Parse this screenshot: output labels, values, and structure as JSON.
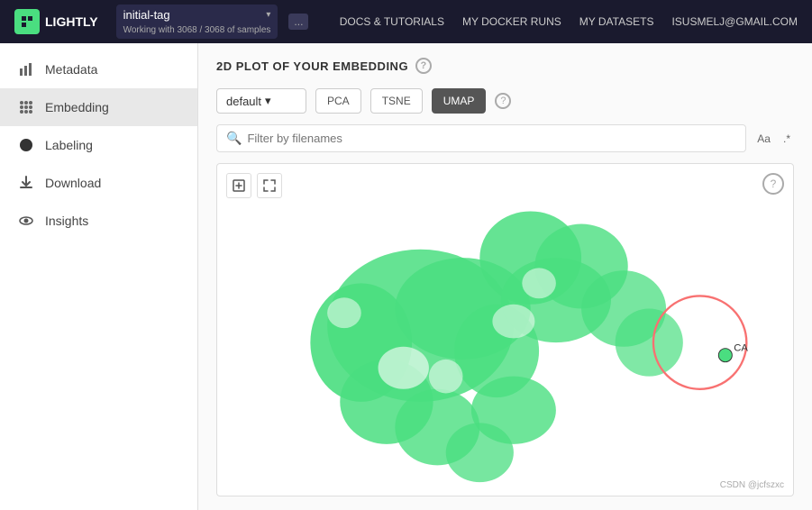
{
  "navbar": {
    "logo_text": "LIGHTLY",
    "logo_char": "L",
    "tag_name": "initial-tag",
    "tag_subtitle": "Working with 3068 / 3068 of samples",
    "tag_more_label": "...",
    "links": [
      {
        "label": "DOCS & TUTORIALS",
        "key": "docs"
      },
      {
        "label": "MY DOCKER RUNS",
        "key": "docker"
      },
      {
        "label": "MY DATASETS",
        "key": "datasets"
      },
      {
        "label": "ISUSMELJ@GMAIL.COM",
        "key": "user"
      }
    ]
  },
  "sidebar": {
    "items": [
      {
        "label": "Metadata",
        "icon": "chart-icon",
        "active": false,
        "key": "metadata"
      },
      {
        "label": "Embedding",
        "icon": "grid-icon",
        "active": true,
        "key": "embedding"
      },
      {
        "label": "Labeling",
        "icon": "circle-icon",
        "active": false,
        "key": "labeling"
      },
      {
        "label": "Download",
        "icon": "download-icon",
        "active": false,
        "key": "download"
      },
      {
        "label": "Insights",
        "icon": "eye-icon",
        "active": false,
        "key": "insights"
      }
    ]
  },
  "main": {
    "section_title": "2D PLOT OF YOUR EMBEDDING",
    "dropdown_default": "default",
    "methods": [
      {
        "label": "PCA",
        "active": false
      },
      {
        "label": "TSNE",
        "active": false
      },
      {
        "label": "UMAP",
        "active": true
      }
    ],
    "search_placeholder": "Filter by filenames",
    "text_case_label": "Aa",
    "text_regex_label": ".*",
    "plot": {
      "cluster_color": "#4ade80",
      "circle_color": "#f87171",
      "cursor_label": "CA"
    }
  },
  "watermark": "CSDN @jcfszxc"
}
